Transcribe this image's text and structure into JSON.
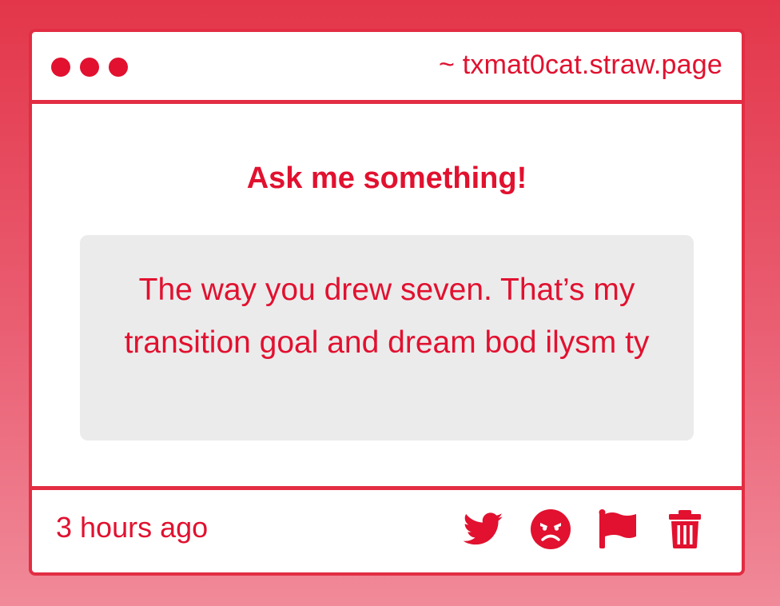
{
  "window": {
    "url": "~ txmat0cat.straw.page"
  },
  "content": {
    "heading": "Ask me something!",
    "question": "The way you drew seven. That’s my transition goal and dream bod ilysm ty"
  },
  "footer": {
    "timestamp": "3 hours ago",
    "actions": [
      {
        "icon": "twitter-icon"
      },
      {
        "icon": "angry-face-icon"
      },
      {
        "icon": "flag-icon"
      },
      {
        "icon": "trash-icon"
      }
    ]
  },
  "colors": {
    "accent": "#e1112f",
    "border": "#e22d43",
    "question_bg": "#ecebec"
  }
}
